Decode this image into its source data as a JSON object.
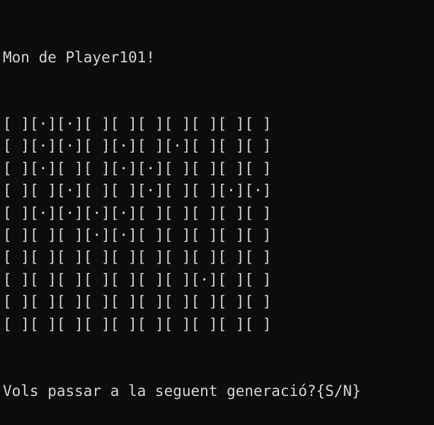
{
  "terminal": {
    "title_line": "Mon de Player101!",
    "prompt_line": "Vols passar a la seguent generació?{S/N}",
    "empty_cell": "[ ]",
    "alive_cell": "[·]",
    "colors": {
      "background": "#0c0c0c",
      "text": "#d4d4d4"
    },
    "grid": [
      [
        0,
        1,
        1,
        0,
        0,
        0,
        0,
        0,
        0,
        0
      ],
      [
        0,
        1,
        1,
        0,
        1,
        0,
        1,
        0,
        0,
        0
      ],
      [
        0,
        1,
        0,
        0,
        1,
        1,
        0,
        0,
        0,
        0
      ],
      [
        0,
        0,
        1,
        0,
        0,
        1,
        0,
        0,
        1,
        1
      ],
      [
        0,
        1,
        1,
        1,
        1,
        0,
        0,
        0,
        0,
        0
      ],
      [
        0,
        0,
        0,
        1,
        1,
        0,
        0,
        0,
        0,
        0
      ],
      [
        0,
        0,
        0,
        0,
        0,
        0,
        0,
        0,
        0,
        0
      ],
      [
        0,
        0,
        0,
        0,
        0,
        0,
        0,
        1,
        0,
        0
      ],
      [
        0,
        0,
        0,
        0,
        0,
        0,
        0,
        0,
        0,
        0
      ],
      [
        0,
        0,
        0,
        0,
        0,
        0,
        0,
        0,
        0,
        0
      ]
    ]
  }
}
